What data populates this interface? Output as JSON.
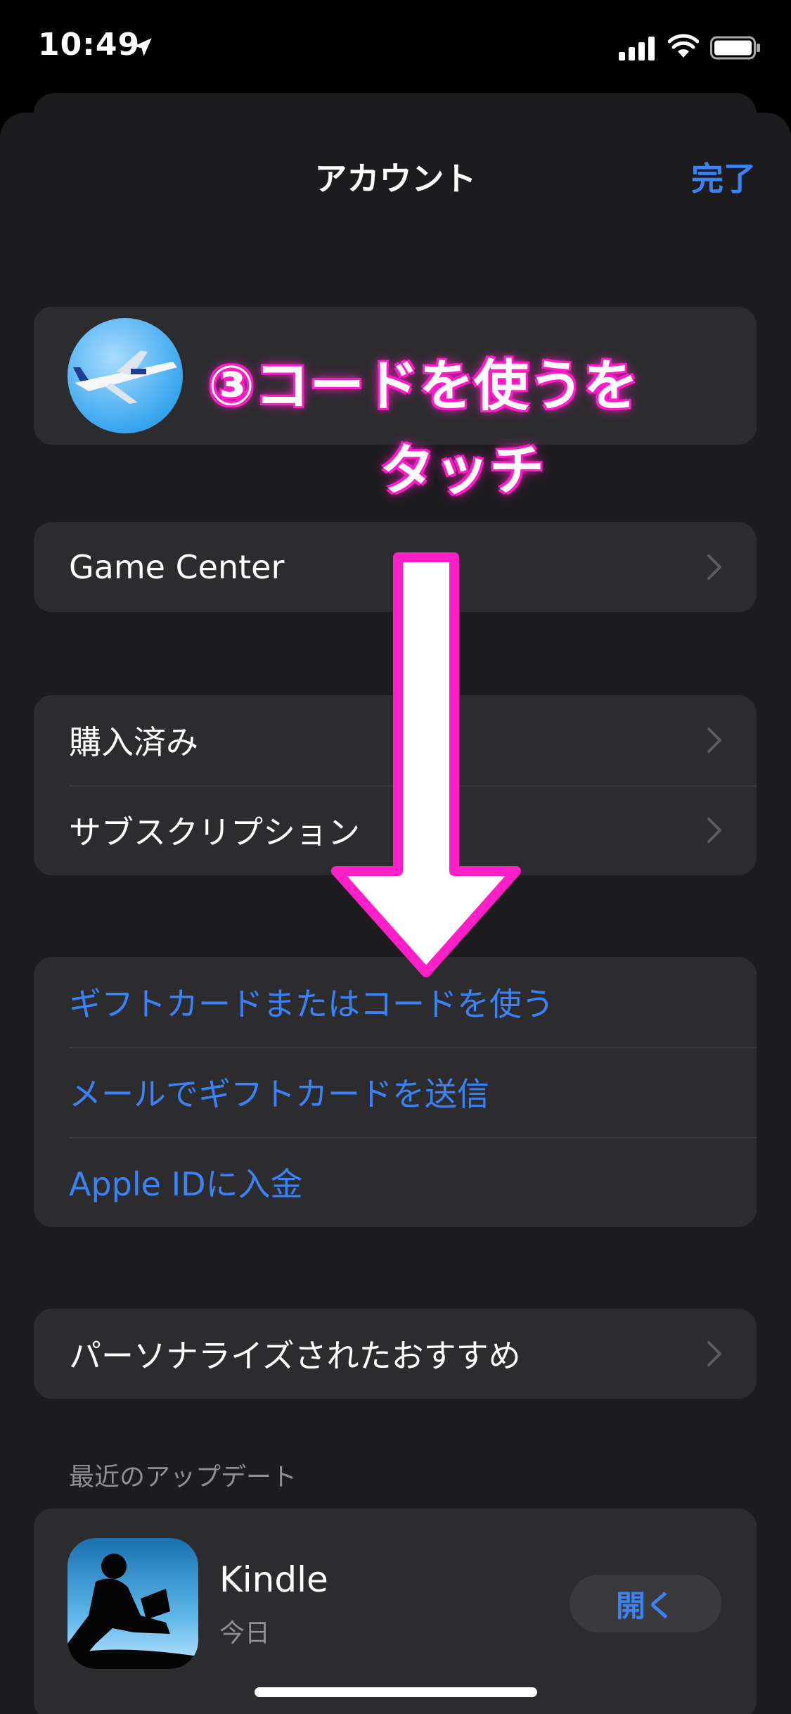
{
  "status_bar": {
    "time": "10:49"
  },
  "nav": {
    "title": "アカウント",
    "done_label": "完了"
  },
  "groups": {
    "game_center": {
      "label": "Game Center"
    },
    "purchases": {
      "purchased": "購入済み",
      "subscriptions": "サブスクリプション"
    },
    "gift": {
      "redeem": "ギフトカードまたはコードを使う",
      "send_gift": "メールでギフトカードを送信",
      "add_funds": "Apple IDに入金"
    },
    "personalized": {
      "label": "パーソナライズされたおすすめ"
    }
  },
  "recent_updates": {
    "header": "最近のアップデート",
    "apps": [
      {
        "name": "Kindle",
        "date": "今日",
        "action": "開く"
      }
    ]
  },
  "annotation": {
    "line1": "③コードを使うを",
    "line2": "タッチ",
    "color": "#ff1ec8"
  },
  "colors": {
    "accent": "#3b82f6",
    "background": "#1c1c1e",
    "cell": "#2c2c2e"
  }
}
